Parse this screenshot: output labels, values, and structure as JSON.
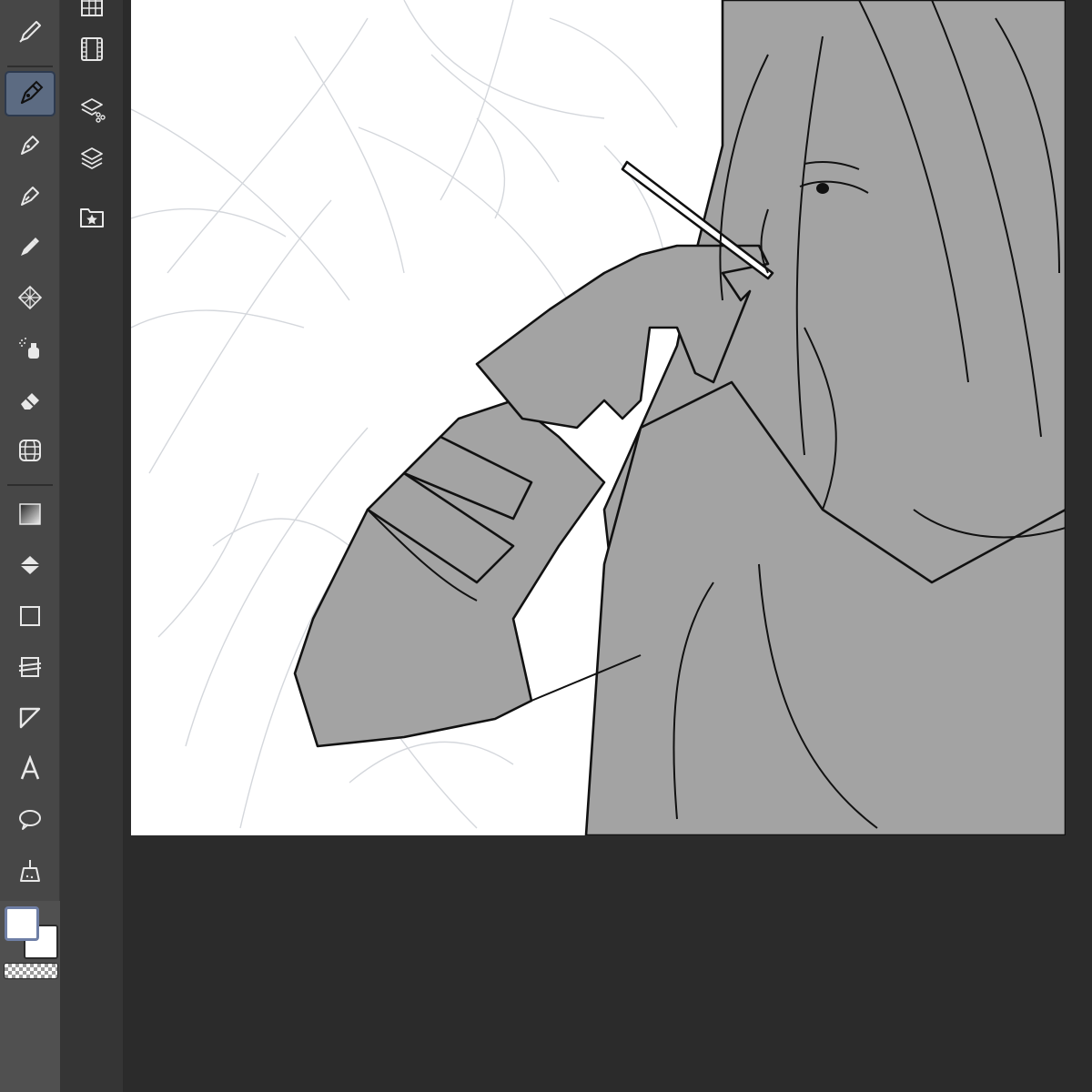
{
  "app": {
    "name": ""
  },
  "toolbar": {
    "tools": [
      {
        "id": "eyedropper",
        "icon": "eyedropper-icon"
      },
      {
        "id": "pen",
        "icon": "pen-nib-icon",
        "active": true
      },
      {
        "id": "pencil",
        "icon": "pencil-icon"
      },
      {
        "id": "brush",
        "icon": "brush-icon"
      },
      {
        "id": "airbrush",
        "icon": "airbrush-icon"
      },
      {
        "id": "decoration",
        "icon": "pattern-icon"
      },
      {
        "id": "spray",
        "icon": "spray-icon"
      },
      {
        "id": "eraser",
        "icon": "eraser-icon"
      },
      {
        "id": "perspective",
        "icon": "globe-grid-icon"
      },
      {
        "id": "gradient",
        "icon": "gradient-icon"
      },
      {
        "id": "fill",
        "icon": "fill-bucket-icon"
      },
      {
        "id": "figure",
        "icon": "rectangle-icon"
      },
      {
        "id": "frame",
        "icon": "frame-border-icon"
      },
      {
        "id": "ruler",
        "icon": "triangle-ruler-icon"
      },
      {
        "id": "text",
        "icon": "text-icon",
        "glyph": "A"
      },
      {
        "id": "balloon",
        "icon": "speech-balloon-icon"
      },
      {
        "id": "correct-line",
        "icon": "broom-icon"
      }
    ],
    "colors": {
      "main": "#ffffff",
      "sub": "#ffffff",
      "accent": "#6f7fa6"
    }
  },
  "palette_bar": {
    "items": [
      {
        "id": "navigator",
        "icon": "grid-thumbnail-icon"
      },
      {
        "id": "timeline",
        "icon": "film-icon"
      },
      {
        "id": "layer-property",
        "icon": "layer-property-icon"
      },
      {
        "id": "layers",
        "icon": "layers-icon"
      },
      {
        "id": "material",
        "icon": "star-folder-icon"
      }
    ]
  },
  "canvas": {
    "background": "#ffffff",
    "fill_color": "#a3a3a3",
    "line_color": "#111111",
    "sketch_color": "#cfd3d8"
  }
}
